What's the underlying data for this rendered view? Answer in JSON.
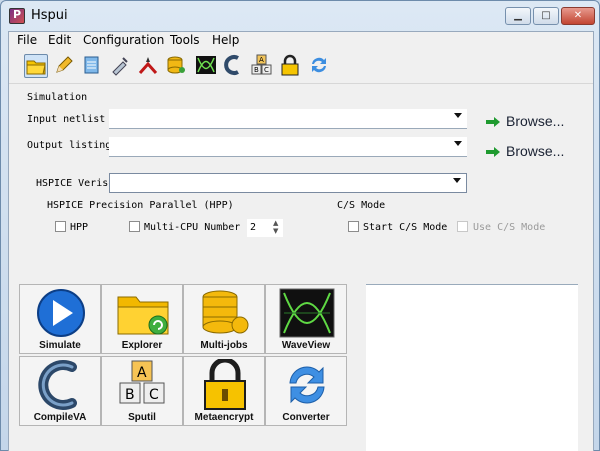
{
  "window": {
    "title": "Hspui"
  },
  "menu": [
    "File",
    "Edit",
    "Configuration",
    "Tools",
    "Help"
  ],
  "toolbar_icons": [
    "open-folder-icon",
    "pencil-icon",
    "notes-icon",
    "syringe-icon",
    "pliers-icon",
    "coins-icon",
    "waveform-icon",
    "phone-c-icon",
    "abc-blocks-icon",
    "padlock-icon",
    "refresh-arrows-icon"
  ],
  "simulation": {
    "section_label": "Simulation",
    "input_netlist_label": "Input netlist f",
    "output_listing_label": "Output listing",
    "browse_label": "Browse...",
    "hspice_version_label": "HSPICE Verison"
  },
  "hpp": {
    "section_label": "HSPICE Precision Parallel  (HPP)",
    "hpp_label": "HPP",
    "multicpu_label": "Multi-CPU Number",
    "multicpu_value": "2"
  },
  "cs_mode": {
    "section_label": "C/S Mode",
    "start_label": "Start C/S Mode",
    "use_label": "Use C/S Mode"
  },
  "tools": [
    {
      "label": "Simulate",
      "icon": "play-icon"
    },
    {
      "label": "Explorer",
      "icon": "folder-icon"
    },
    {
      "label": "Multi-jobs",
      "icon": "coins-icon"
    },
    {
      "label": "WaveView",
      "icon": "waveform-icon"
    },
    {
      "label": "CompileVA",
      "icon": "compile-c-icon"
    },
    {
      "label": "Sputil",
      "icon": "abc-blocks-icon"
    },
    {
      "label": "Metaencrypt",
      "icon": "padlock-icon"
    },
    {
      "label": "Converter",
      "icon": "refresh-arrows-icon"
    }
  ]
}
